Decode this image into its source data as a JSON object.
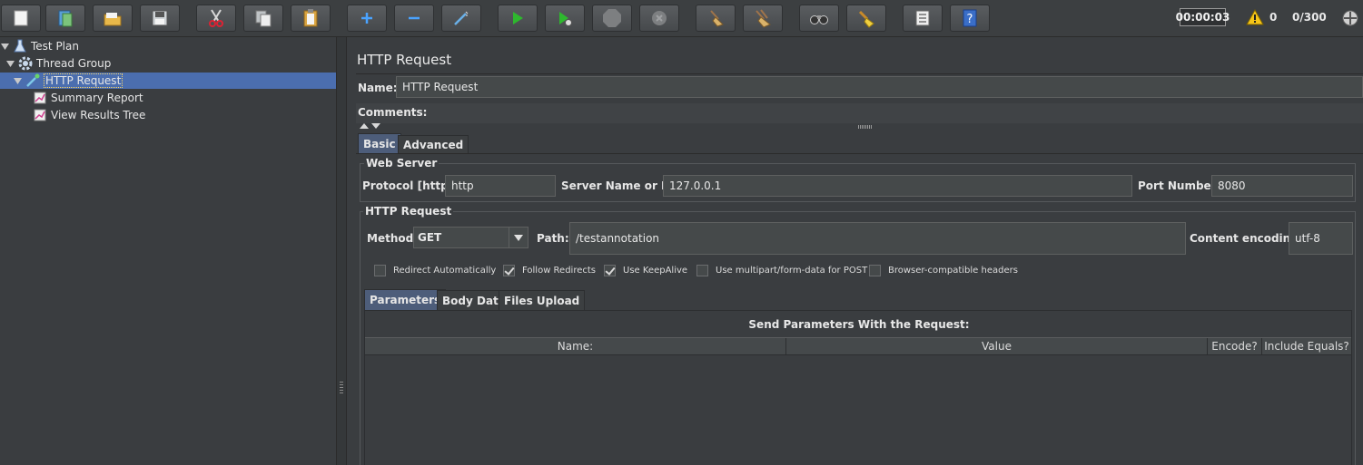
{
  "toolbar": {
    "buttons": [
      {
        "name": "new-button",
        "icon": "new-file-icon"
      },
      {
        "name": "templates-button",
        "icon": "templates-icon"
      },
      {
        "name": "open-button",
        "icon": "folder-open-icon"
      },
      {
        "name": "save-button",
        "icon": "floppy-disk-icon"
      },
      {
        "name": "cut-button",
        "icon": "scissors-icon"
      },
      {
        "name": "copy-button",
        "icon": "copy-icon"
      },
      {
        "name": "paste-button",
        "icon": "clipboard-icon"
      },
      {
        "name": "expand-all-button",
        "icon": "plus-icon"
      },
      {
        "name": "collapse-all-button",
        "icon": "minus-icon"
      },
      {
        "name": "toggle-button",
        "icon": "wand-icon"
      },
      {
        "name": "start-button",
        "icon": "play-icon"
      },
      {
        "name": "start-no-pauses-button",
        "icon": "play-no-pause-icon"
      },
      {
        "name": "stop-button",
        "icon": "stop-icon"
      },
      {
        "name": "shutdown-button",
        "icon": "shutdown-icon"
      },
      {
        "name": "clear-button",
        "icon": "broom-icon"
      },
      {
        "name": "clear-all-button",
        "icon": "broom-all-icon"
      },
      {
        "name": "search-button",
        "icon": "binoculars-icon"
      },
      {
        "name": "reset-search-button",
        "icon": "brush-icon"
      },
      {
        "name": "function-helper-button",
        "icon": "list-icon"
      },
      {
        "name": "help-button",
        "icon": "help-icon"
      }
    ],
    "timer": "00:00:03",
    "warning_count": "0",
    "threads": "0/300"
  },
  "tree": {
    "items": [
      {
        "label": "Test Plan",
        "icon": "flask-icon"
      },
      {
        "label": "Thread Group",
        "icon": "gear-icon"
      },
      {
        "label": "HTTP Request",
        "icon": "pipette-icon"
      },
      {
        "label": "Summary Report",
        "icon": "chart-icon"
      },
      {
        "label": "View Results Tree",
        "icon": "chart-icon"
      }
    ]
  },
  "panel": {
    "title": "HTTP Request",
    "name_label": "Name:",
    "name_value": "HTTP Request",
    "comments_label": "Comments:",
    "tabs": [
      "Basic",
      "Advanced"
    ],
    "web_server": {
      "title": "Web Server",
      "protocol_label": "Protocol [http]:",
      "protocol_value": "http",
      "server_label": "Server Name or IP:",
      "server_value": "127.0.0.1",
      "port_label": "Port Number:",
      "port_value": "8080"
    },
    "http_request": {
      "title": "HTTP Request",
      "method_label": "Method:",
      "method_value": "GET",
      "path_label": "Path:",
      "path_value": "/testannotation",
      "encoding_label": "Content encoding:",
      "encoding_value": "utf-8"
    },
    "checkboxes": [
      {
        "label": "Redirect Automatically",
        "checked": false
      },
      {
        "label": "Follow Redirects",
        "checked": true
      },
      {
        "label": "Use KeepAlive",
        "checked": true
      },
      {
        "label": "Use multipart/form-data for POST",
        "checked": false
      },
      {
        "label": "Browser-compatible headers",
        "checked": false
      }
    ],
    "sub_tabs": [
      "Parameters",
      "Body Data",
      "Files Upload"
    ],
    "params_caption": "Send Parameters With the Request:",
    "columns": [
      "Name:",
      "Value",
      "Encode?",
      "Include Equals?"
    ]
  },
  "colors": {
    "selection": "#4b6eaf",
    "active_tab": "#4d5d7a",
    "background": "#3a3d40"
  }
}
